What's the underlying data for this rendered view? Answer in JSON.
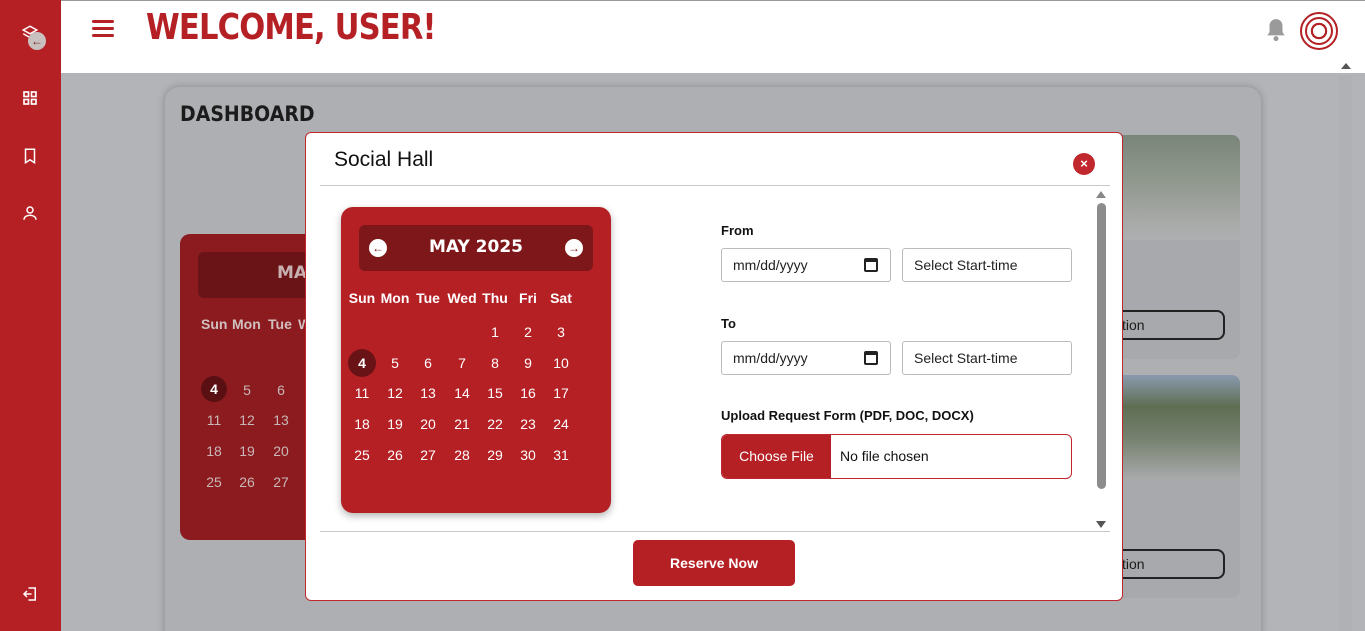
{
  "header": {
    "title": "WELCOME, USER!"
  },
  "dashboard": {
    "title": "DASHBOARD",
    "bg_calendar": {
      "month": "MAY",
      "days_of_week": [
        "Sun",
        "Mon",
        "Tue",
        "W"
      ],
      "days": [
        "4",
        "5",
        "6",
        "11",
        "12",
        "13",
        "18",
        "19",
        "20",
        "25",
        "26",
        "27"
      ]
    },
    "card_button_partial": "tion"
  },
  "modal": {
    "title": "Social Hall",
    "close_label": "×",
    "calendar": {
      "month_label": "MAY 2025",
      "prev_icon": "←",
      "next_icon": "→",
      "days_of_week": [
        "Sun",
        "Mon",
        "Tue",
        "Wed",
        "Thu",
        "Fri",
        "Sat"
      ],
      "weeks": [
        [
          "",
          "",
          "",
          "",
          "1",
          "2",
          "3"
        ],
        [
          "4",
          "5",
          "6",
          "7",
          "8",
          "9",
          "10"
        ],
        [
          "11",
          "12",
          "13",
          "14",
          "15",
          "16",
          "17"
        ],
        [
          "18",
          "19",
          "20",
          "21",
          "22",
          "23",
          "24"
        ],
        [
          "25",
          "26",
          "27",
          "28",
          "29",
          "30",
          "31"
        ]
      ],
      "selected_day": "4"
    },
    "from": {
      "label": "From",
      "date_placeholder": "mm/dd/yyyy",
      "time_placeholder": "Select Start-time"
    },
    "to": {
      "label": "To",
      "date_placeholder": "mm/dd/yyyy",
      "time_placeholder": "Select Start-time"
    },
    "upload": {
      "label": "Upload Request Form (PDF, DOC, DOCX)",
      "button": "Choose File",
      "status": "No file chosen"
    },
    "submit_label": "Reserve Now"
  },
  "colors": {
    "brand": "#b52025",
    "brand_dark": "#7e171a"
  }
}
